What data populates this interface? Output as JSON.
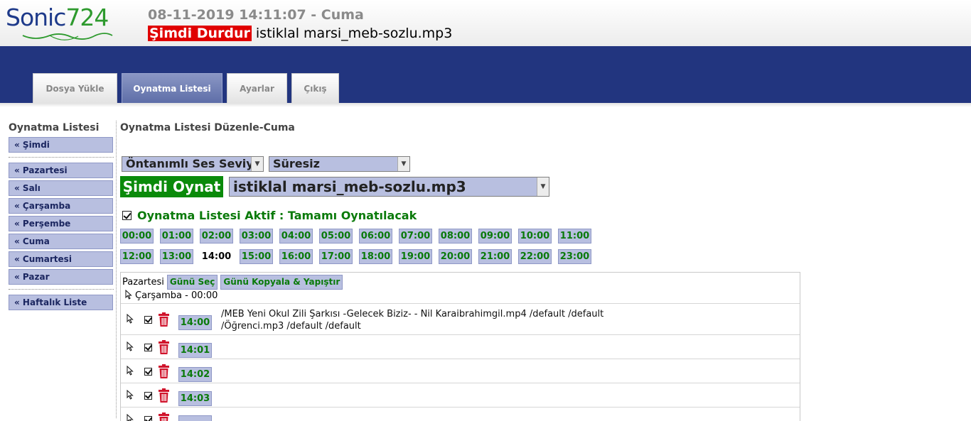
{
  "header": {
    "logo_part1": "Sonic",
    "logo_part2": "724",
    "datetime": "08-11-2019 14:11:07 - Cuma",
    "stop_label": "Şimdi Durdur",
    "now_playing": "istiklal marsi_meb-sozlu.mp3"
  },
  "nav": {
    "tabs": [
      {
        "label": "Dosya Yükle"
      },
      {
        "label": "Oynatma Listesi"
      },
      {
        "label": "Ayarlar"
      },
      {
        "label": "Çıkış"
      }
    ],
    "active_tab": "Oynatma Listesi"
  },
  "sidebar": {
    "title": "Oynatma Listesi",
    "now": "« Şimdi",
    "days": [
      "« Pazartesi",
      "« Salı",
      "« Çarşamba",
      "« Perşembe",
      "« Cuma",
      "« Cumartesi",
      "« Pazar"
    ],
    "weekly": "« Haftalık Liste"
  },
  "main": {
    "title": "Oynatma Listesi Düzenle-Cuma",
    "volume_select": "Öntanımlı Ses Seviyes",
    "duration_select": "Süresiz",
    "play_now_label": "Şimdi Oynat",
    "file_select": "istiklal marsi_meb-sozlu.mp3",
    "playlist_active": "Oynatma Listesi Aktif : Tamamı Oynatılacak",
    "hours": [
      "00:00",
      "01:00",
      "02:00",
      "03:00",
      "04:00",
      "05:00",
      "06:00",
      "07:00",
      "08:00",
      "09:00",
      "10:00",
      "11:00",
      "12:00",
      "13:00",
      "14:00",
      "15:00",
      "16:00",
      "17:00",
      "18:00",
      "19:00",
      "20:00",
      "21:00",
      "22:00",
      "23:00"
    ],
    "selected_hour": "14:00"
  },
  "schedule": {
    "day_label": "Pazartesi",
    "select_day_label": "Günü Seç",
    "copy_paste_label": "Günü Kopyala & Yapıştır",
    "copy_target": "Çarşamba - 00:00",
    "rows": [
      {
        "time": "14:00",
        "files": [
          "/MEB Yeni Okul Zili Şarkısı -Gelecek Biziz- - Nil Karaibrahimgil.mp4 /default /default",
          "/Öğrenci.mp3 /default /default"
        ]
      },
      {
        "time": "14:01",
        "files": []
      },
      {
        "time": "14:02",
        "files": []
      },
      {
        "time": "14:03",
        "files": []
      },
      {
        "time": "",
        "files": []
      }
    ]
  },
  "colors": {
    "brand_blue": "#22357f",
    "active_green": "#0a7a0a",
    "stop_red": "#e00000",
    "button_lilac": "#b8bfe0",
    "trash_red": "#d0142c"
  }
}
